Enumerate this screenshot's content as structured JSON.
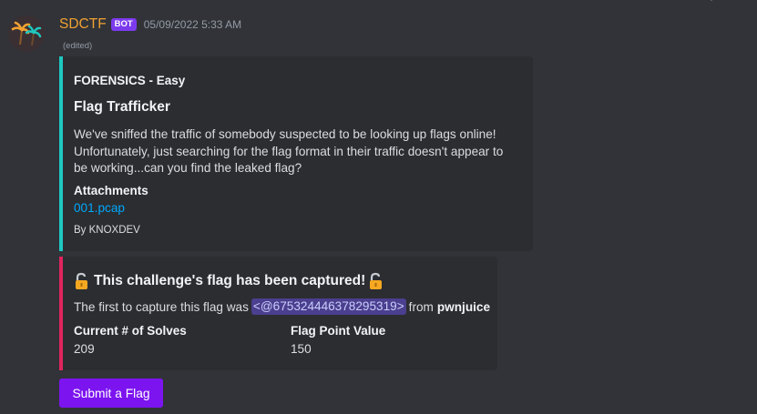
{
  "message": {
    "author": "SDCTF",
    "bot_tag": "BOT",
    "timestamp": "05/09/2022 5:33 AM",
    "edited": "(edited)",
    "avatar_icon": "palm-trees-icon",
    "author_color": "#f0a232"
  },
  "challenge_embed": {
    "accent_color": "#1ec8c0",
    "category": "FORENSICS - Easy",
    "title": "Flag Trafficker",
    "description": "We've sniffed the traffic of somebody suspected to be looking up flags online! Unfortunately, just searching for the flag format in their traffic doesn't appear to be working...can you find the leaked flag?",
    "attachments_label": "Attachments",
    "attachment_file": "001.pcap",
    "footer": "By KNOXDEV"
  },
  "capture_embed": {
    "accent_color": "#e0245e",
    "title": "This challenge's flag has been captured!",
    "title_icon": "open-lock-icon",
    "desc_prefix": "The first to capture this flag was",
    "mention": "<@675324446378295319>",
    "desc_mid": "from",
    "team": "pwnjuice",
    "fields": [
      {
        "name": "Current # of Solves",
        "value": "209"
      },
      {
        "name": "Flag Point Value",
        "value": "150"
      }
    ]
  },
  "actions": {
    "submit_label": "Submit a Flag",
    "submit_color": "#7c14f0"
  }
}
